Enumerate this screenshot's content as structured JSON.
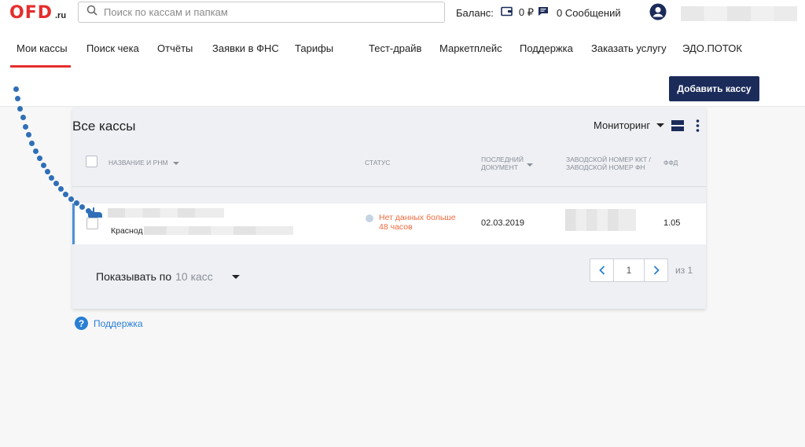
{
  "header": {
    "logo_main": "OFD",
    "logo_suffix": ".ru",
    "search_placeholder": "Поиск по кассам и папкам",
    "balance_label": "Баланс:",
    "balance_value": "0 ₽",
    "messages_label": "0 Сообщений",
    "icons": {
      "search": "search-icon",
      "wallet": "wallet-icon",
      "messages": "message-icon",
      "user": "user-avatar-icon"
    }
  },
  "nav": {
    "items": [
      {
        "label": "Мои кассы",
        "active": true
      },
      {
        "label": "Поиск чека"
      },
      {
        "label": "Отчёты"
      },
      {
        "label": "Заявки в ФНС"
      },
      {
        "label": "Тарифы"
      },
      {
        "label": "Тест-драйв"
      },
      {
        "label": "Маркетплейс"
      },
      {
        "label": "Поддержка"
      },
      {
        "label": "Заказать услугу"
      },
      {
        "label": "ЭДО.ПОТОК"
      }
    ],
    "add_button": "Добавить кассу"
  },
  "panel": {
    "title": "Все кассы",
    "monitoring_label": "Мониторинг",
    "columns": {
      "name": "Название и РНМ",
      "status": "Статус",
      "last_doc": "Последний документ",
      "serial": "Заводской номер ККТ / заводской номер ФН",
      "ffd": "ФФД"
    },
    "row": {
      "address_prefix": "Краснод",
      "status": "Нет данных больше 48 часов",
      "last_doc": "02.03.2019",
      "ffd": "1.05"
    },
    "per_page_label": "Показывать по",
    "per_page_value": "10 касс",
    "page": "1",
    "of_pages": "из 1"
  },
  "support_link": "Поддержка",
  "colors": {
    "brand_red": "#e52d2d",
    "navy": "#1b2b5a",
    "status_warning": "#f26a3d",
    "link_blue": "#2a7fd4"
  }
}
